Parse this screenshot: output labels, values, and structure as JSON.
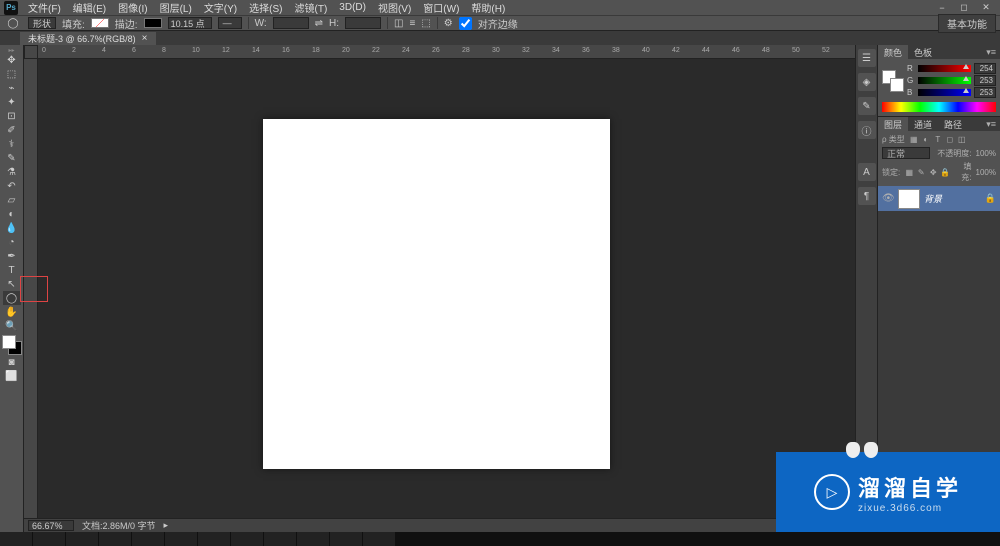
{
  "menu": {
    "file": "文件(F)",
    "edit": "编辑(E)",
    "image": "图像(I)",
    "layer": "图层(L)",
    "type": "文字(Y)",
    "select": "选择(S)",
    "filter": "滤镜(T)",
    "threed": "3D(D)",
    "view": "视图(V)",
    "window": "窗口(W)",
    "help": "帮助(H)"
  },
  "options": {
    "shape_label": "形状",
    "fill_label": "填充:",
    "stroke_label": "描边:",
    "stroke_value": "10.15 点",
    "w_label": "W:",
    "h_label": "H:",
    "align_label": "对齐边缘"
  },
  "workspace": {
    "label": "基本功能"
  },
  "document": {
    "tab": "未标题-3 @ 66.7%(RGB/8)"
  },
  "status": {
    "zoom": "66.67%",
    "doc_info": "文档:2.86M/0 字节"
  },
  "ruler_ticks": [
    "0",
    "2",
    "4",
    "6",
    "8",
    "10",
    "12",
    "14",
    "16",
    "18",
    "20",
    "22",
    "24",
    "26",
    "28",
    "30",
    "32",
    "34",
    "36",
    "38",
    "40",
    "42",
    "44",
    "46",
    "48",
    "50",
    "52"
  ],
  "panels": {
    "color_tab": "颜色",
    "swatches_tab": "色板",
    "r": "R",
    "g": "G",
    "b": "B",
    "r_val": "254",
    "g_val": "253",
    "b_val": "253",
    "layers_tab": "图层",
    "channels_tab": "通道",
    "paths_tab": "路径",
    "blend_mode": "正常",
    "opacity_label": "不透明度:",
    "opacity_val": "100%",
    "lock_label": "锁定:",
    "fill_label": "填充:",
    "fill_val": "100%",
    "layer_name": "背景"
  },
  "watermark": {
    "cn": "溜溜自学",
    "url": "zixue.3d66.com"
  }
}
